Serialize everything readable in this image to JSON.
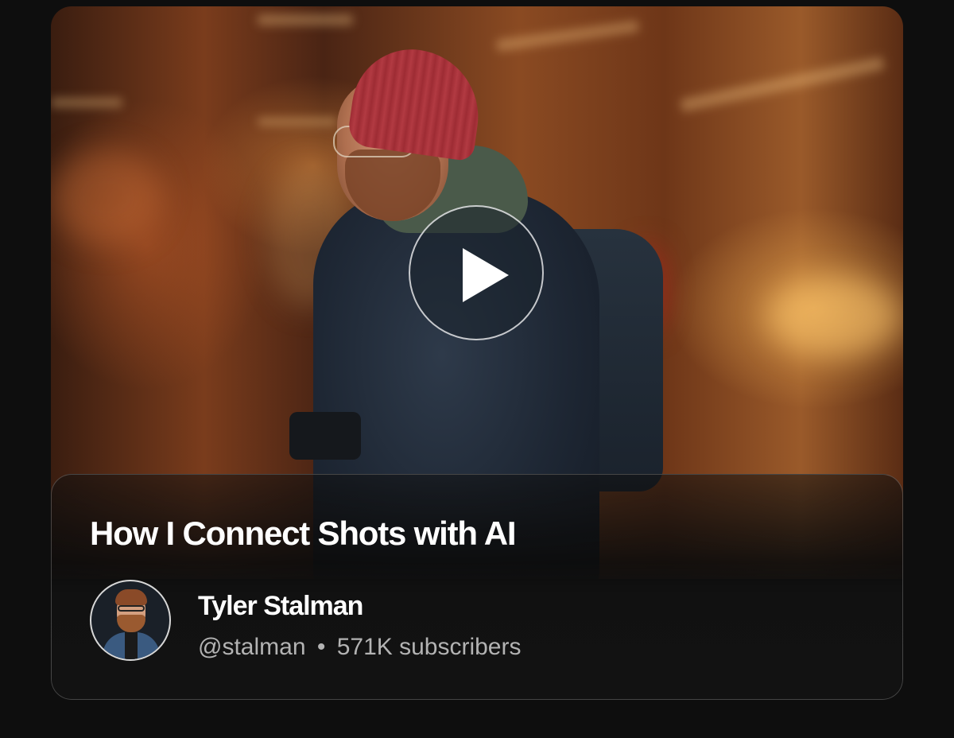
{
  "video": {
    "title": "How I Connect Shots with AI",
    "play_icon": "play-icon"
  },
  "channel": {
    "name": "Tyler Stalman",
    "handle": "@stalman",
    "separator": "•",
    "subscribers": "571K subscribers"
  },
  "colors": {
    "background": "#0e0e0e",
    "card": "#111111",
    "title": "#ffffff",
    "meta": "#b3b3b3"
  }
}
